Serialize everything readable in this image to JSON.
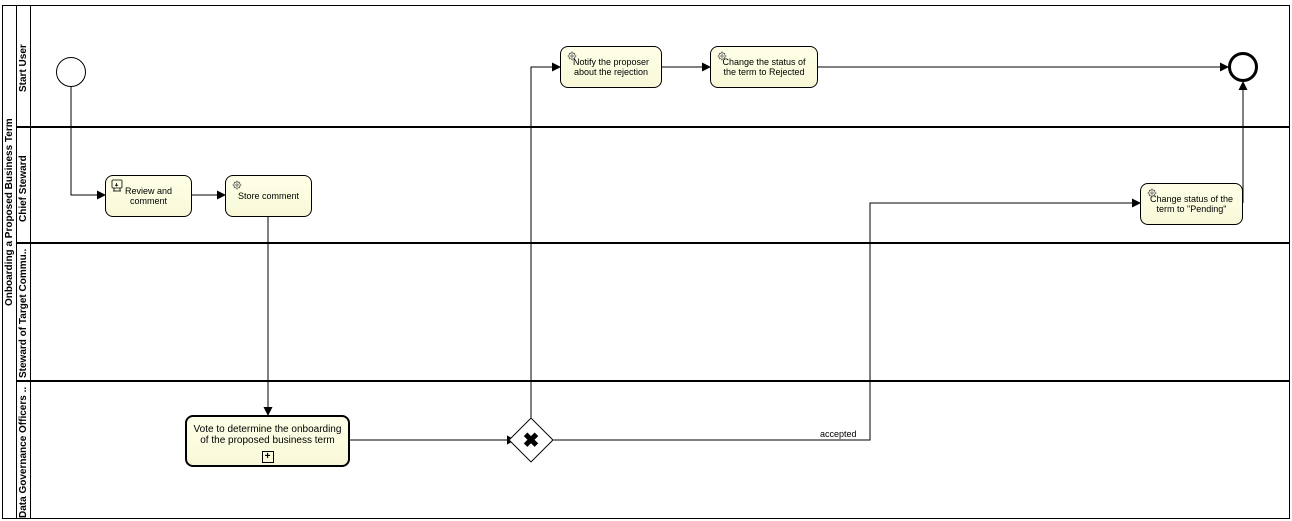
{
  "pool": {
    "title": "Onboarding a Proposed Business Term"
  },
  "lanes": {
    "startUser": "Start User",
    "chiefSteward": "Chief Steward",
    "stewardTarget": "Steward of Target Commu..",
    "dgOfficers": "Data Governance Officers .."
  },
  "tasks": {
    "review": "Review and\ncomment",
    "store": "Store comment",
    "vote": "Vote to determine the onboarding of the proposed business term",
    "notify": "Notify the proposer about the rejection",
    "changeRejected": "Change the status of the term to Rejected",
    "changePending": "Change status of the term to \"Pending\""
  },
  "labels": {
    "accepted": "accepted"
  }
}
